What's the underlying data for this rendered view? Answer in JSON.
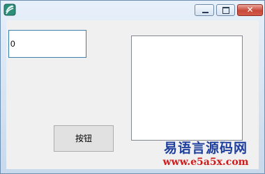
{
  "window": {
    "title": "",
    "app_icon": "app-icon",
    "controls": {
      "minimize_icon": "minimize-icon",
      "maximize_icon": "maximize-icon",
      "close_icon": "close-icon",
      "close_glyph": "✕"
    }
  },
  "form": {
    "edit_box": {
      "value": "0"
    },
    "button": {
      "label": "按钮"
    },
    "picture_box": {}
  },
  "watermark": {
    "title": "易语言源码网",
    "url": "www.e5a5x.com"
  },
  "colors": {
    "close_button": "#c8483a",
    "edit_border": "#3c7fb1",
    "watermark_title": "#1f3f9e",
    "watermark_url": "#d11b1b"
  }
}
